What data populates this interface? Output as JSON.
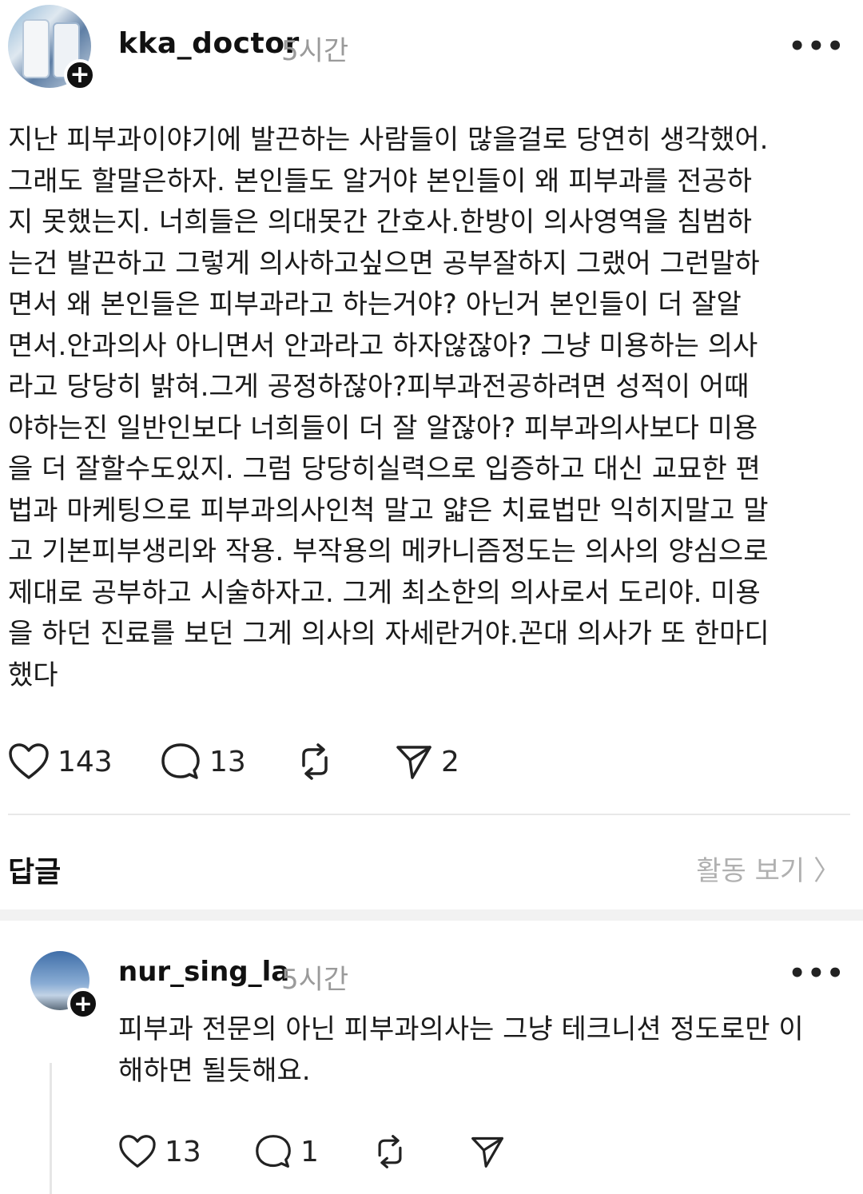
{
  "post": {
    "username": "kka_doctor",
    "time": "5시간",
    "more_icon": "more-dots-icon",
    "lines": [
      "지난 피부과이야기에 발끈하는 사람들이 많을걸로 당연히 생각했어.",
      "그래도 할말은하자. 본인들도 알거야 본인들이 왜 피부과를 전공하",
      "지 못했는지. 너희들은 의대못간 간호사.한방이 의사영역을 침범하",
      "는건 발끈하고 그렇게 의사하고싶으면 공부잘하지 그랬어 그런말하",
      "면서 왜 본인들은 피부과라고 하는거야?  아닌거 본인들이 더 잘알",
      "면서.안과의사 아니면서 안과라고 하자않잖아?  그냥 미용하는 의사",
      "라고 당당히 밝혀.그게 공정하잖아?피부과전공하려면 성적이 어때",
      "야하는진 일반인보다 너희들이 더 잘 알잖아?  피부과의사보다 미용",
      "을 더 잘할수도있지. 그럼 당당히실력으로 입증하고 대신 교묘한 편",
      "법과 마케팅으로 피부과의사인척 말고 얇은 치료법만 익히지말고 말",
      "고 기본피부생리와 작용. 부작용의 메카니즘정도는 의사의 양심으로",
      "제대로 공부하고 시술하자고. 그게 최소한의 의사로서 도리야. 미용",
      "을 하던 진료를 보던 그게 의사의 자세란거야.꼰대 의사가 또 한마디",
      "했다"
    ],
    "likes": "143",
    "comments": "13",
    "reposts": "",
    "shares": "2"
  },
  "section": {
    "replies_label": "답글",
    "activity_link": "활동 보기 〉"
  },
  "reply": {
    "username": "nur_sing_la",
    "time": "5시간",
    "lines": [
      "피부과 전문의 아닌 피부과의사는 그냥 테크니션 정도로만 이",
      "해하면 될듯해요."
    ],
    "likes": "13",
    "comments": "1"
  }
}
